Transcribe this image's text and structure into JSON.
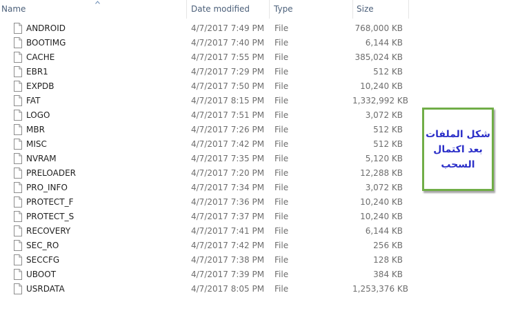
{
  "header": {
    "name": "Name",
    "date_modified": "Date modified",
    "type": "Type",
    "size": "Size"
  },
  "files": [
    {
      "name": "ANDROID",
      "date": "4/7/2017 7:49 PM",
      "type": "File",
      "size": "768,000 KB"
    },
    {
      "name": "BOOTIMG",
      "date": "4/7/2017 7:40 PM",
      "type": "File",
      "size": "6,144 KB"
    },
    {
      "name": "CACHE",
      "date": "4/7/2017 7:55 PM",
      "type": "File",
      "size": "385,024 KB"
    },
    {
      "name": "EBR1",
      "date": "4/7/2017 7:29 PM",
      "type": "File",
      "size": "512 KB"
    },
    {
      "name": "EXPDB",
      "date": "4/7/2017 7:50 PM",
      "type": "File",
      "size": "10,240 KB"
    },
    {
      "name": "FAT",
      "date": "4/7/2017 8:15 PM",
      "type": "File",
      "size": "1,332,992 KB"
    },
    {
      "name": "LOGO",
      "date": "4/7/2017 7:51 PM",
      "type": "File",
      "size": "3,072 KB"
    },
    {
      "name": "MBR",
      "date": "4/7/2017 7:26 PM",
      "type": "File",
      "size": "512 KB"
    },
    {
      "name": "MISC",
      "date": "4/7/2017 7:42 PM",
      "type": "File",
      "size": "512 KB"
    },
    {
      "name": "NVRAM",
      "date": "4/7/2017 7:35 PM",
      "type": "File",
      "size": "5,120 KB"
    },
    {
      "name": "PRELOADER",
      "date": "4/7/2017 7:20 PM",
      "type": "File",
      "size": "12,288 KB"
    },
    {
      "name": "PRO_INFO",
      "date": "4/7/2017 7:34 PM",
      "type": "File",
      "size": "3,072 KB"
    },
    {
      "name": "PROTECT_F",
      "date": "4/7/2017 7:36 PM",
      "type": "File",
      "size": "10,240 KB"
    },
    {
      "name": "PROTECT_S",
      "date": "4/7/2017 7:37 PM",
      "type": "File",
      "size": "10,240 KB"
    },
    {
      "name": "RECOVERY",
      "date": "4/7/2017 7:41 PM",
      "type": "File",
      "size": "6,144 KB"
    },
    {
      "name": "SEC_RO",
      "date": "4/7/2017 7:42 PM",
      "type": "File",
      "size": "256 KB"
    },
    {
      "name": "SECCFG",
      "date": "4/7/2017 7:38 PM",
      "type": "File",
      "size": "128 KB"
    },
    {
      "name": "UBOOT",
      "date": "4/7/2017 7:39 PM",
      "type": "File",
      "size": "384 KB"
    },
    {
      "name": "USRDATA",
      "date": "4/7/2017 8:05 PM",
      "type": "File",
      "size": "1,253,376 KB"
    }
  ],
  "annotation": {
    "lines": [
      "شكل الملفات",
      "بعد اكتمال",
      "السحب"
    ],
    "text_color": "#2b2fc8",
    "border_color": "#70ad47"
  },
  "icons": {
    "file": "file-icon",
    "sort": "sort-ascending-icon"
  }
}
